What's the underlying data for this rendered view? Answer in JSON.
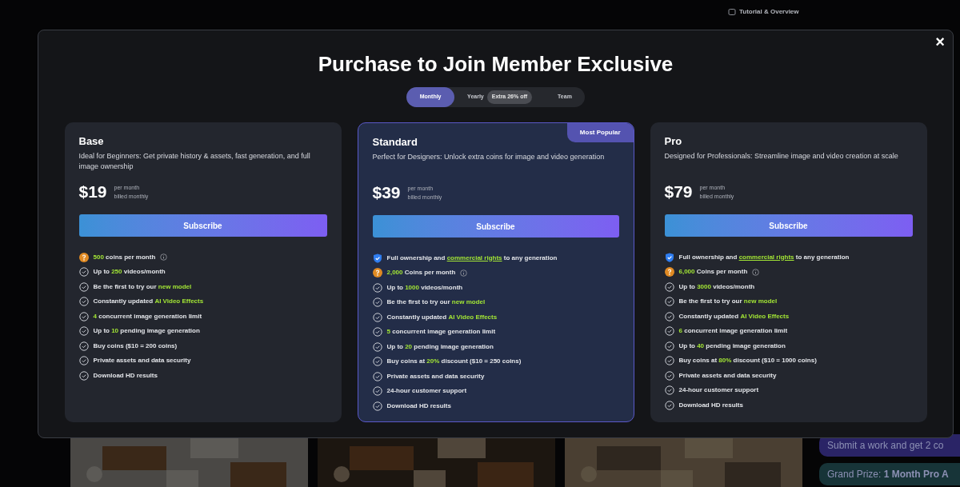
{
  "background": {
    "tutorial_link": "Tutorial & Overview",
    "promos": [
      {
        "text": "Submit a work and get 2 co"
      },
      {
        "text": "Grand Prize:",
        "bold": "1 Month Pro A"
      }
    ]
  },
  "modal": {
    "title": "Purchase to Join Member Exclusive",
    "close": "×",
    "billing_tabs": [
      {
        "label": "Monthly",
        "selected": true
      },
      {
        "label": "Yearly",
        "badge": "Extra 26% off",
        "selected": false
      },
      {
        "label": "Team",
        "selected": false
      }
    ],
    "plans": [
      {
        "name": "Base",
        "highlighted": false,
        "description": "Ideal for Beginners: Get private history & assets, fast generation, and full image ownership",
        "price": "$19",
        "period": "per month",
        "billing": "billed monthly",
        "button": "Subscribe",
        "features": [
          {
            "kind": "coin",
            "text": "**500** coins per month",
            "info": true
          },
          {
            "kind": "check",
            "text": "Up to **250** videos/month"
          },
          {
            "kind": "check",
            "text": "Be the first to try our **new model**"
          },
          {
            "kind": "check",
            "text": "Constantly updated **AI Video Effects**"
          },
          {
            "kind": "check",
            "text": "**4** concurrent image generation limit"
          },
          {
            "kind": "check",
            "text": "Up to **10** pending image generation"
          },
          {
            "kind": "check",
            "text": "Buy coins ($10 = 200 coins)"
          },
          {
            "kind": "check",
            "text": "Private assets and data security"
          },
          {
            "kind": "check",
            "text": "Download HD results"
          }
        ]
      },
      {
        "name": "Standard",
        "highlighted": true,
        "ribbon": "Most Popular",
        "description": "Perfect for Designers: Unlock extra coins for image and video generation",
        "price": "$39",
        "period": "per month",
        "billing": "billed monthly",
        "button": "Subscribe",
        "features": [
          {
            "kind": "shield",
            "text": "Full ownership and ",
            "link": "commercial rights",
            "after": " to any generation"
          },
          {
            "kind": "coin",
            "text": "**2,000** Coins per month",
            "info": true
          },
          {
            "kind": "check",
            "text": "Up to **1000** videos/month"
          },
          {
            "kind": "check",
            "text": "Be the first to try our **new model**"
          },
          {
            "kind": "check",
            "text": "Constantly updated **AI Video Effects**"
          },
          {
            "kind": "check",
            "text": "**5** concurrent image generation limit"
          },
          {
            "kind": "check",
            "text": "Up to **20** pending image generation"
          },
          {
            "kind": "check",
            "text": "Buy coins at **20%** discount ($10 = 250 coins)"
          },
          {
            "kind": "check",
            "text": "Private assets and data security"
          },
          {
            "kind": "check",
            "text": "24-hour customer support"
          },
          {
            "kind": "check",
            "text": "Download HD results"
          }
        ]
      },
      {
        "name": "Pro",
        "highlighted": false,
        "description": "Designed for Professionals: Streamline image and video creation at scale",
        "price": "$79",
        "period": "per month",
        "billing": "billed monthly",
        "button": "Subscribe",
        "features": [
          {
            "kind": "shield",
            "text": "Full ownership and ",
            "link": "commercial rights",
            "after": " to any generation"
          },
          {
            "kind": "coin",
            "text": "**6,000** Coins per month",
            "info": true
          },
          {
            "kind": "check",
            "text": "Up to **3000** videos/month"
          },
          {
            "kind": "check",
            "text": "Be the first to try our **new model**"
          },
          {
            "kind": "check",
            "text": "Constantly updated **AI Video Effects**"
          },
          {
            "kind": "check",
            "text": "**6** concurrent image generation limit"
          },
          {
            "kind": "check",
            "text": "Up to **40** pending image generation"
          },
          {
            "kind": "check",
            "text": "Buy coins at **80%** discount ($10 = 1000 coins)"
          },
          {
            "kind": "check",
            "text": "Private assets and data security"
          },
          {
            "kind": "check",
            "text": "24-hour customer support"
          },
          {
            "kind": "check",
            "text": "Download HD results"
          }
        ]
      }
    ]
  }
}
